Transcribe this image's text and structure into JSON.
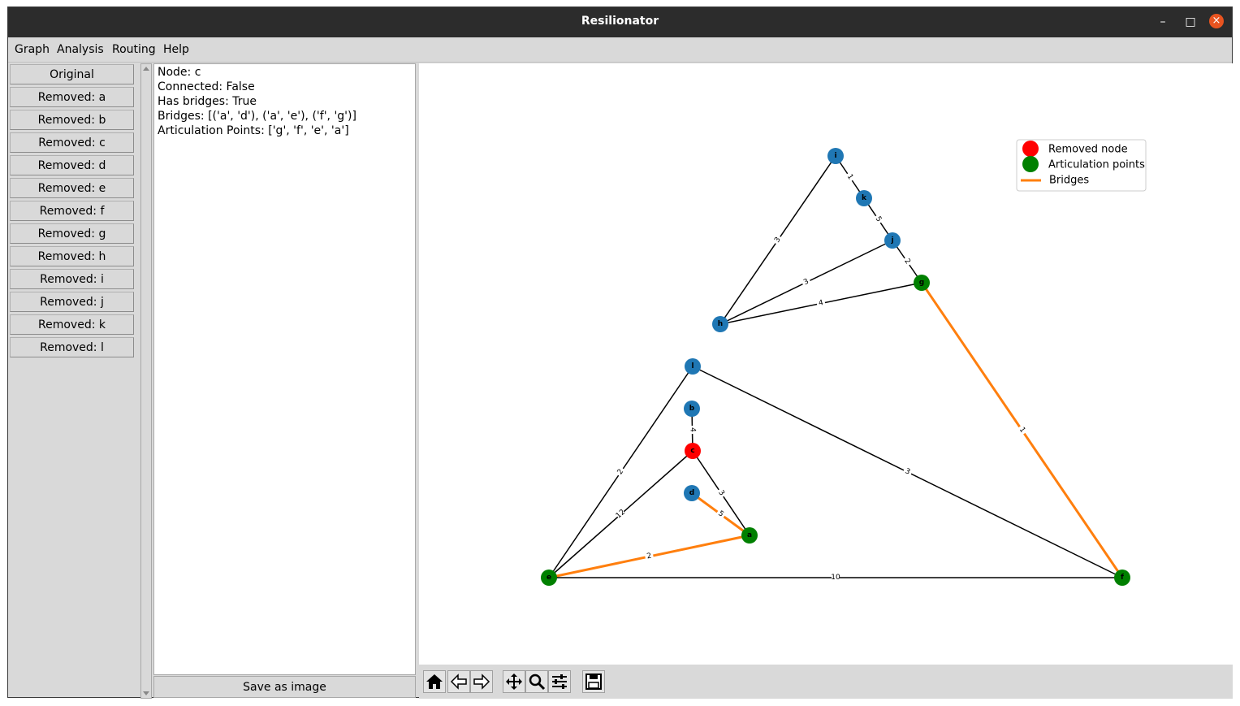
{
  "window": {
    "title": "Resilionator",
    "minimize_glyph": "–",
    "maximize_glyph": "□",
    "close_glyph": "×"
  },
  "menu": [
    "Graph",
    "Analysis",
    "Routing",
    "Help"
  ],
  "sidebar": {
    "buttons": [
      "Original",
      "Removed: a",
      "Removed: b",
      "Removed: c",
      "Removed: d",
      "Removed: e",
      "Removed: f",
      "Removed: g",
      "Removed: h",
      "Removed: i",
      "Removed: j",
      "Removed: k",
      "Removed: l"
    ]
  },
  "info": {
    "lines": [
      "Node: c",
      "Connected: False",
      "Has bridges: True",
      "Bridges: [('a', 'd'), ('a', 'e'), ('f', 'g')]",
      "Articulation Points: ['g', 'f', 'e', 'a']"
    ]
  },
  "save_button": "Save as image",
  "toolbar": {
    "tools": [
      "home-icon",
      "back-icon",
      "forward-icon",
      "pan-icon",
      "zoom-icon",
      "configure-subplots-icon",
      "save-icon"
    ]
  },
  "graph": {
    "colors": {
      "normal": "#1f77b4",
      "removed": "#ff0000",
      "articulation": "#008000",
      "bridge": "#ff7f0e",
      "edge": "#000000"
    },
    "legend": [
      {
        "label": "Removed node",
        "kind": "removed"
      },
      {
        "label": "Articulation points",
        "kind": "articulation"
      },
      {
        "label": "Bridges",
        "kind": "bridge"
      }
    ],
    "nodes": [
      {
        "id": "i",
        "status": "normal"
      },
      {
        "id": "k",
        "status": "normal"
      },
      {
        "id": "j",
        "status": "normal"
      },
      {
        "id": "g",
        "status": "articulation"
      },
      {
        "id": "h",
        "status": "normal"
      },
      {
        "id": "l",
        "status": "normal"
      },
      {
        "id": "b",
        "status": "normal"
      },
      {
        "id": "c",
        "status": "removed"
      },
      {
        "id": "d",
        "status": "normal"
      },
      {
        "id": "a",
        "status": "articulation"
      },
      {
        "id": "e",
        "status": "articulation"
      },
      {
        "id": "f",
        "status": "articulation"
      }
    ],
    "edges": [
      {
        "from": "i",
        "to": "k",
        "weight": "1",
        "bridge": false
      },
      {
        "from": "k",
        "to": "j",
        "weight": "5",
        "bridge": false
      },
      {
        "from": "j",
        "to": "g",
        "weight": "2",
        "bridge": false
      },
      {
        "from": "i",
        "to": "h",
        "weight": "3",
        "bridge": false
      },
      {
        "from": "h",
        "to": "j",
        "weight": "3",
        "bridge": false
      },
      {
        "from": "h",
        "to": "g",
        "weight": "4",
        "bridge": false
      },
      {
        "from": "g",
        "to": "f",
        "weight": "1",
        "bridge": true
      },
      {
        "from": "l",
        "to": "e",
        "weight": "2",
        "bridge": false
      },
      {
        "from": "l",
        "to": "f",
        "weight": "3",
        "bridge": false
      },
      {
        "from": "b",
        "to": "c",
        "weight": "4",
        "bridge": false
      },
      {
        "from": "c",
        "to": "e",
        "weight": "12",
        "bridge": false
      },
      {
        "from": "c",
        "to": "a",
        "weight": "3",
        "bridge": false
      },
      {
        "from": "d",
        "to": "a",
        "weight": "5",
        "bridge": true
      },
      {
        "from": "a",
        "to": "e",
        "weight": "2",
        "bridge": true
      },
      {
        "from": "e",
        "to": "f",
        "weight": "10",
        "bridge": false
      }
    ]
  }
}
